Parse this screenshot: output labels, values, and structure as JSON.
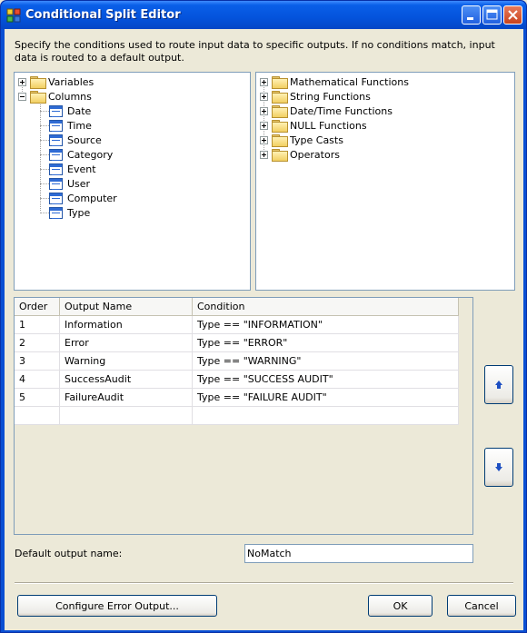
{
  "window": {
    "title": "Conditional Split Editor"
  },
  "description": "Specify the conditions used to route input data to specific outputs. If no conditions match, input data is routed to a default output.",
  "left_tree": {
    "nodes": [
      {
        "label": "Variables",
        "expanded": false,
        "icon": "folder-icon"
      },
      {
        "label": "Columns",
        "expanded": true,
        "icon": "folder-icon"
      }
    ],
    "columns": [
      "Date",
      "Time",
      "Source",
      "Category",
      "Event",
      "User",
      "Computer",
      "Type"
    ]
  },
  "right_tree": {
    "nodes": [
      "Mathematical Functions",
      "String Functions",
      "Date/Time Functions",
      "NULL Functions",
      "Type Casts",
      "Operators"
    ]
  },
  "grid": {
    "headers": {
      "order": "Order",
      "name": "Output Name",
      "condition": "Condition"
    },
    "rows": [
      {
        "order": "1",
        "name": "Information",
        "condition": "Type == \"INFORMATION\""
      },
      {
        "order": "2",
        "name": "Error",
        "condition": "Type == \"ERROR\""
      },
      {
        "order": "3",
        "name": "Warning",
        "condition": "Type == \"WARNING\""
      },
      {
        "order": "4",
        "name": "SuccessAudit",
        "condition": "Type == \"SUCCESS AUDIT\""
      },
      {
        "order": "5",
        "name": "FailureAudit",
        "condition": "Type == \"FAILURE AUDIT\""
      },
      {
        "order": "",
        "name": "",
        "condition": ""
      }
    ]
  },
  "default_output": {
    "label": "Default output name:",
    "value": "NoMatch"
  },
  "buttons": {
    "configure_error": "Configure Error Output...",
    "ok": "OK",
    "cancel": "Cancel",
    "move_up_icon": "arrow-up-icon",
    "move_down_icon": "arrow-down-icon"
  },
  "colors": {
    "titlebar": "#0453dc",
    "dialog_bg": "#ece9d8",
    "accent_arrow": "#1e4fc2"
  }
}
